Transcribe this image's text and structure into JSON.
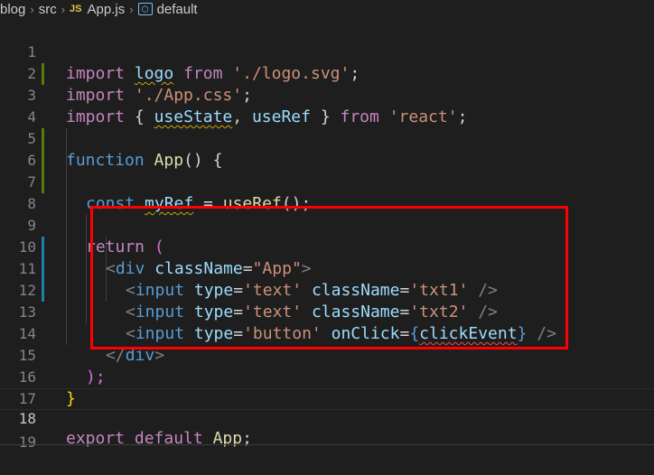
{
  "breadcrumb": {
    "folder1": "blog",
    "folder2": "src",
    "file_badge": "JS",
    "file": "App.js",
    "symbol": "default"
  },
  "lines": [
    {
      "n": "1"
    },
    {
      "n": "2"
    },
    {
      "n": "3"
    },
    {
      "n": "4"
    },
    {
      "n": "5"
    },
    {
      "n": "6"
    },
    {
      "n": "7"
    },
    {
      "n": "8"
    },
    {
      "n": "9"
    },
    {
      "n": "10"
    },
    {
      "n": "11"
    },
    {
      "n": "12"
    },
    {
      "n": "13"
    },
    {
      "n": "14"
    },
    {
      "n": "15"
    },
    {
      "n": "16"
    },
    {
      "n": "17"
    },
    {
      "n": "18"
    },
    {
      "n": "19"
    }
  ],
  "code": {
    "l1": {
      "import": "import",
      "logo": "logo",
      "from": "from",
      "path": "'./logo.svg'",
      "semi": ";"
    },
    "l2": {
      "import": "import",
      "path": "'./App.css'",
      "semi": ";"
    },
    "l3": {
      "import": "import",
      "open": "{ ",
      "useState": "useState",
      "comma": ", ",
      "useRef": "useRef",
      "close": " } ",
      "from": "from",
      "path": "'react'",
      "semi": ";"
    },
    "l5": {
      "function": "function",
      "name": "App",
      "parens": "() {"
    },
    "l7": {
      "const": "const",
      "myRef": "myRef",
      "eq": " = ",
      "useRef": "useRef",
      "call": "();"
    },
    "l9": {
      "return": "return",
      "paren": "("
    },
    "l10": {
      "open": "<",
      "tag": "div",
      "attr": "className",
      "eq": "=",
      "val": "\"App\"",
      "close": ">"
    },
    "l11": {
      "open": "<",
      "tag": "input",
      "type_attr": "type",
      "type_val": "'text'",
      "class_attr": "className",
      "class_val": "'txt1'",
      "close": "/>"
    },
    "l12": {
      "open": "<",
      "tag": "input",
      "type_attr": "type",
      "type_val": "'text'",
      "class_attr": "className",
      "class_val": "'txt2'",
      "close": "/>"
    },
    "l13": {
      "open": "<",
      "tag": "input",
      "type_attr": "type",
      "type_val": "'button'",
      "click_attr": "onClick",
      "lbrace": "{",
      "handler": "clickEvent",
      "rbrace": "}",
      "close": "/>"
    },
    "l14": {
      "open": "</",
      "tag": "div",
      "close": ">"
    },
    "l15": {
      "text": ");"
    },
    "l16": {
      "text": "}"
    },
    "l18": {
      "export": "export",
      "default": "default",
      "name": "App",
      "semi": ";"
    }
  },
  "colors": {
    "keyword_control": "#c586c0",
    "string": "#ce9178",
    "variable": "#9cdcfe",
    "function": "#dcdcaa",
    "keyword": "#569cd6",
    "highlight_box": "#ff0000"
  },
  "icons": {
    "chevron": "chevron-right-icon",
    "symbol": "symbol-object-icon"
  }
}
